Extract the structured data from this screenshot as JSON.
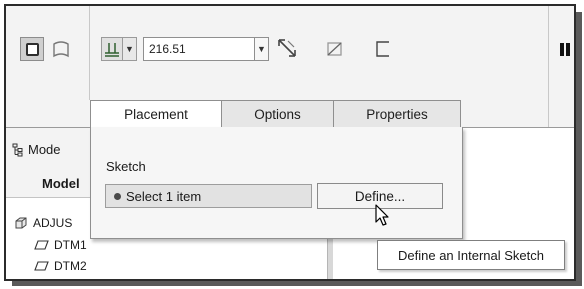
{
  "toolbar": {
    "depth_value": "216.51",
    "icons": {
      "solid": "solid-icon",
      "surface": "surface-icon",
      "depth_type": "blind-depth-icon",
      "flip": "flip-direction-icon",
      "remove_material": "remove-material-icon",
      "thicken": "thicken-sketch-icon",
      "pause": "pause-icon"
    }
  },
  "tabs": [
    {
      "label": "Placement",
      "active": true
    },
    {
      "label": "Options",
      "active": false
    },
    {
      "label": "Properties",
      "active": false
    }
  ],
  "tree": {
    "tab_label": "Mode",
    "title": "Model",
    "items": [
      {
        "label": "ADJUS",
        "icon": "part-icon"
      },
      {
        "label": "DTM1",
        "icon": "datum-plane-icon"
      },
      {
        "label": "DTM2",
        "icon": "datum-plane-icon"
      }
    ]
  },
  "placement": {
    "section_label": "Sketch",
    "collector_text": "Select 1 item",
    "define_label": "Define..."
  },
  "tooltip": {
    "text": "Define an Internal Sketch"
  },
  "colors": {
    "ribbon_bg": "#f3f3f3",
    "panel_bg": "#f6f6f6",
    "collector_bg": "#e2e2e2",
    "border": "#8f8f8f"
  }
}
